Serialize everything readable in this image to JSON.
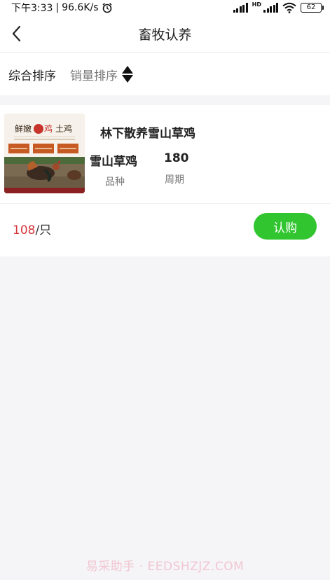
{
  "status_bar": {
    "time": "下午3:33",
    "separator": "|",
    "speed": "96.6K/s",
    "network_badge": "HD",
    "battery": "62",
    "icons": [
      "alarm-icon",
      "signal-icon",
      "wifi-icon",
      "battery-icon"
    ]
  },
  "nav": {
    "title": "畜牧认养",
    "back_icon": "back-arrow-icon"
  },
  "sort": {
    "option1": "综合排序",
    "option2": "销量排序",
    "sort_icon": "sort-updown-icon"
  },
  "product": {
    "name": "林下散养雪山草鸡",
    "breed_value": "雪山草鸡",
    "breed_label": "品种",
    "cycle_value": "180",
    "cycle_label": "周期",
    "price": "108",
    "unit": "/只",
    "buy_label": "认购",
    "image": {
      "headline": "鲜嫩",
      "stamp": "鸡",
      "headline_tail": "土鸡"
    }
  },
  "watermark": "易采助手 · EEDSHZJZ.COM",
  "colors": {
    "accent_green": "#31c530",
    "price_red": "#d6343a",
    "background": "#f5f5f7"
  }
}
